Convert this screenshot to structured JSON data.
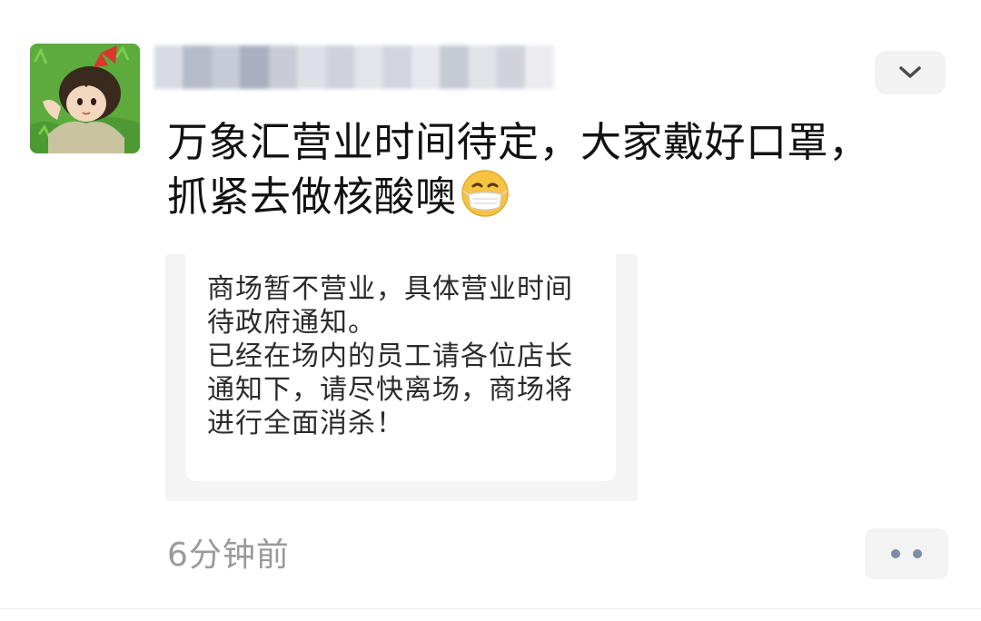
{
  "post": {
    "text_lines": [
      "万象汇营业时间待定，大家戴好口罩，",
      "抓紧去做核酸噢"
    ],
    "emoji": "mask-face-emoji",
    "timestamp": "6分钟前"
  },
  "attachment": {
    "notice_lines": [
      "商场暂不营业，具体营业时间",
      "待政府通知。",
      "已经在场内的员工请各位店长",
      "通知下，请尽快离场，商场将",
      "进行全面消杀！"
    ]
  },
  "icons": {
    "collapse": "chevron-down-icon",
    "more": "more-dots-icon",
    "avatar": "avatar-image"
  },
  "colors": {
    "text": "#121212",
    "timestamp": "#9a9a9a",
    "action_button_bg": "#f2f2f2",
    "more_dots": "#7a8ca8"
  }
}
